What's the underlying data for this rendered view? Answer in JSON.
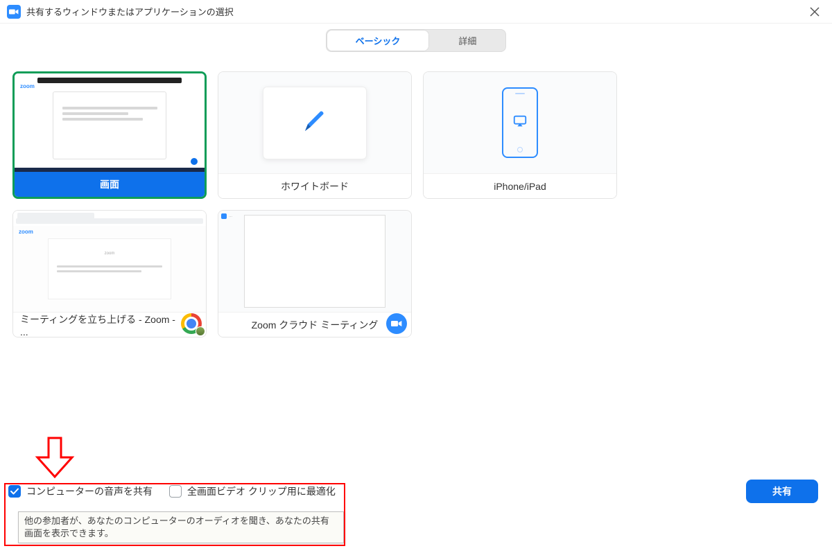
{
  "window": {
    "title": "共有するウィンドウまたはアプリケーションの選択",
    "close_aria": "Close"
  },
  "tabs": {
    "basic": "ベーシック",
    "advanced": "詳細"
  },
  "tiles": {
    "screen": {
      "label": "画面",
      "thumb_brand": "zoom"
    },
    "whiteboard": {
      "label": "ホワイトボード"
    },
    "iphone": {
      "label": "iPhone/iPad"
    },
    "chrome_window": {
      "label": "ミーティングを立ち上げる - Zoom - ...",
      "thumb_brand": "zoom"
    },
    "zoom_window": {
      "label": "Zoom クラウド ミーティング"
    }
  },
  "footer": {
    "share_audio_label": "コンピューターの音声を共有",
    "share_audio_checked": true,
    "optimize_video_label": "全画面ビデオ クリップ用に最適化",
    "optimize_video_checked": false,
    "share_button": "共有",
    "tooltip": "他の参加者が、あなたのコンピューターのオーディオを聞き、あなたの共有画面を表示できます。"
  },
  "colors": {
    "primary": "#0e71eb",
    "zoom_blue": "#2d8cff",
    "selected_border": "#0e9d58",
    "annotation_red": "#ff0000"
  },
  "icons": {
    "app": "zoom-camera-icon",
    "close": "close-icon",
    "pen": "pen-icon",
    "airplay": "airplay-icon",
    "chrome": "chrome-icon",
    "check": "check-icon"
  }
}
